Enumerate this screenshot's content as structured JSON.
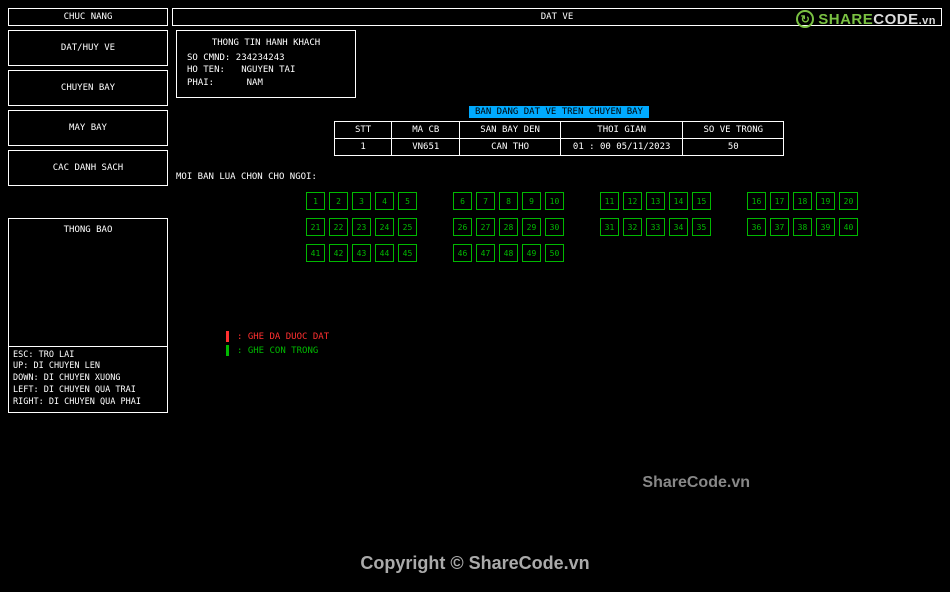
{
  "header": {
    "chuc_nang": "CHUC NANG",
    "dat_ve": "DAT VE"
  },
  "menu": {
    "items": [
      "DAT/HUY VE",
      "CHUYEN BAY",
      "MAY BAY",
      "CAC DANH SACH"
    ]
  },
  "thong_bao": {
    "title": "THONG BAO",
    "keys": {
      "esc": "ESC: TRO LAI",
      "up": "UP: DI CHUYEN LEN",
      "down": "DOWN: DI CHUYEN XUONG",
      "left": "LEFT: DI CHUYEN QUA TRAI",
      "right": "RIGHT: DI CHUYEN QUA PHAI"
    }
  },
  "passenger": {
    "title": "THONG TIN HANH KHACH",
    "so_cmnd_label": "SO CMND:",
    "so_cmnd": "234234243",
    "ho_ten_label": "HO TEN:",
    "ho_ten": "NGUYEN TAI",
    "phai_label": "PHAI:",
    "phai": "NAM"
  },
  "banner": "BAN DANG DAT VE TREN CHUYEN BAY",
  "flight": {
    "headers": {
      "stt": "STT",
      "ma_cb": "MA CB",
      "san_bay_den": "SAN BAY DEN",
      "thoi_gian": "THOI GIAN",
      "so_ve_trong": "SO VE TRONG"
    },
    "row": {
      "stt": "1",
      "ma_cb": "VN651",
      "san_bay_den": "CAN THO",
      "thoi_gian": "01 : 00  05/11/2023",
      "so_ve_trong": "50"
    }
  },
  "choose_label": "MOI BAN LUA CHON CHO NGOI:",
  "seats": {
    "total": 50,
    "groups_per_row": 4,
    "seats_per_group": 5
  },
  "legend": {
    "booked": ": GHE DA DUOC DAT",
    "free": ": GHE CON TRONG"
  },
  "watermark": {
    "brand_green": "SHARE",
    "brand_white": "CODE",
    "suffix": ".vn",
    "mid": "ShareCode.vn",
    "bottom": "Copyright © ShareCode.vn"
  }
}
